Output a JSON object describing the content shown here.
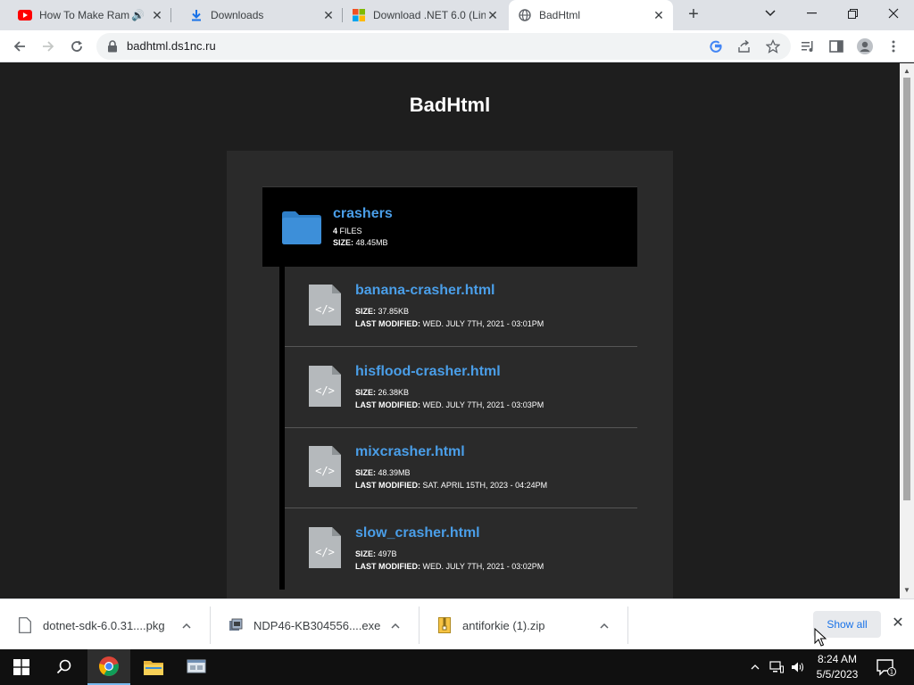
{
  "browser": {
    "tabs": [
      {
        "title": "How To Make Ram",
        "icon": "youtube-icon",
        "audio": true
      },
      {
        "title": "Downloads",
        "icon": "download-icon"
      },
      {
        "title": "Download .NET 6.0 (Lin",
        "icon": "microsoft-icon"
      },
      {
        "title": "BadHtml",
        "icon": "globe-icon",
        "active": true
      }
    ],
    "url": "badhtml.ds1nc.ru"
  },
  "page": {
    "title": "BadHtml",
    "folder": {
      "name": "crashers",
      "files_count": "4",
      "files_label": "FILES",
      "size_label": "SIZE:",
      "size_value": "48.45MB"
    },
    "files": [
      {
        "name": "banana-crasher.html",
        "size_label": "SIZE:",
        "size": "37.85KB",
        "modified_label": "LAST MODIFIED:",
        "modified": "WED. JULY 7TH, 2021 - 03:01PM"
      },
      {
        "name": "hisflood-crasher.html",
        "size_label": "SIZE:",
        "size": "26.38KB",
        "modified_label": "LAST MODIFIED:",
        "modified": "WED. JULY 7TH, 2021 - 03:03PM"
      },
      {
        "name": "mixcrasher.html",
        "size_label": "SIZE:",
        "size": "48.39MB",
        "modified_label": "LAST MODIFIED:",
        "modified": "SAT. APRIL 15TH, 2023 - 04:24PM"
      },
      {
        "name": "slow_crasher.html",
        "size_label": "SIZE:",
        "size": "497B",
        "modified_label": "LAST MODIFIED:",
        "modified": "WED. JULY 7TH, 2021 - 03:02PM"
      }
    ]
  },
  "downloads": {
    "items": [
      {
        "name": "dotnet-sdk-6.0.31....pkg",
        "icon": "file-icon"
      },
      {
        "name": "NDP46-KB304556....exe",
        "icon": "installer-icon"
      },
      {
        "name": "antiforkie (1).zip",
        "icon": "zip-icon"
      }
    ],
    "show_all": "Show all"
  },
  "taskbar": {
    "time": "8:24 AM",
    "date": "5/5/2023"
  },
  "colors": {
    "link": "#4a9ee8",
    "folder": "#3d8fd9",
    "page_bg": "#1e1e1e",
    "panel_bg": "#2a2a2a"
  }
}
